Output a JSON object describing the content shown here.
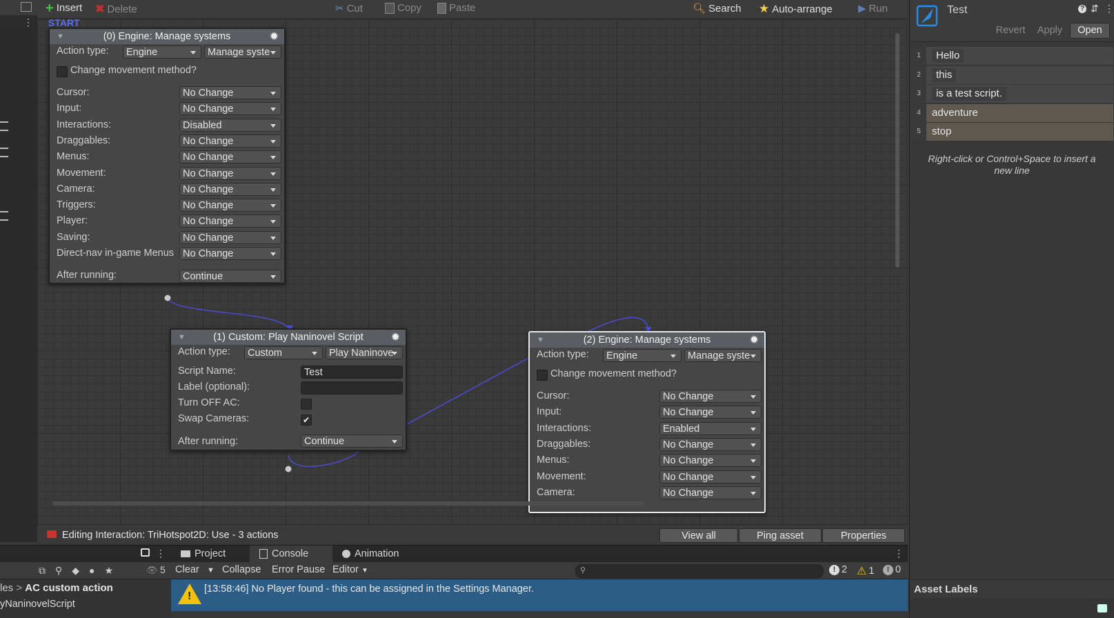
{
  "toolbar": {
    "insert": "Insert",
    "delete": "Delete",
    "cut": "Cut",
    "copy": "Copy",
    "paste": "Paste",
    "search": "Search",
    "auto_arrange": "Auto-arrange",
    "run": "Run"
  },
  "graph": {
    "start_label": "START",
    "node0": {
      "title": "(0) Engine: Manage systems",
      "action_type_label": "Action type:",
      "action_type": "Engine",
      "action_sub": "Manage syste",
      "change_movement": "Change movement method?",
      "fields": [
        {
          "label": "Cursor:",
          "value": "No Change"
        },
        {
          "label": "Input:",
          "value": "No Change"
        },
        {
          "label": "Interactions:",
          "value": "Disabled"
        },
        {
          "label": "Draggables:",
          "value": "No Change"
        },
        {
          "label": "Menus:",
          "value": "No Change"
        },
        {
          "label": "Movement:",
          "value": "No Change"
        },
        {
          "label": "Camera:",
          "value": "No Change"
        },
        {
          "label": "Triggers:",
          "value": "No Change"
        },
        {
          "label": "Player:",
          "value": "No Change"
        },
        {
          "label": "Saving:",
          "value": "No Change"
        },
        {
          "label": "Direct-nav in-game Menus",
          "value": "No Change"
        }
      ],
      "after_running_label": "After running:",
      "after_running": "Continue"
    },
    "node1": {
      "title": "(1) Custom: Play Naninovel Script",
      "action_type_label": "Action type:",
      "action_type": "Custom",
      "action_sub": "Play Naninove",
      "script_name_label": "Script Name:",
      "script_name": "Test",
      "label_optional_label": "Label (optional):",
      "label_optional": "",
      "turn_off_label": "Turn OFF AC:",
      "swap_cameras_label": "Swap Cameras:",
      "after_running_label": "After running:",
      "after_running": "Continue"
    },
    "node2": {
      "title": "(2) Engine: Manage systems",
      "action_type_label": "Action type:",
      "action_type": "Engine",
      "action_sub": "Manage syste",
      "change_movement": "Change movement method?",
      "fields": [
        {
          "label": "Cursor:",
          "value": "No Change"
        },
        {
          "label": "Input:",
          "value": "No Change"
        },
        {
          "label": "Interactions:",
          "value": "Enabled"
        },
        {
          "label": "Draggables:",
          "value": "No Change"
        },
        {
          "label": "Menus:",
          "value": "No Change"
        },
        {
          "label": "Movement:",
          "value": "No Change"
        },
        {
          "label": "Camera:",
          "value": "No Change"
        }
      ]
    }
  },
  "status": {
    "editing": "Editing Interaction: TriHotspot2D: Use - 3 actions",
    "view_all": "View all",
    "ping_asset": "Ping asset",
    "properties": "Properties"
  },
  "console": {
    "tabs": [
      "Project",
      "Console",
      "Animation"
    ],
    "eye_count": "5",
    "clear": "Clear",
    "collapse": "Collapse",
    "error_pause": "Error Pause",
    "editor": "Editor",
    "count_info": "2",
    "count_warn": "1",
    "count_error": "0",
    "log_message": "[13:58:46] No Player found - this can be assigned in the Settings Manager.",
    "breadcrumb_prefix": "les",
    "breadcrumb_current": "AC custom action",
    "file_item": "yNaninovelScript"
  },
  "inspector": {
    "title": "Test",
    "revert": "Revert",
    "apply": "Apply",
    "open": "Open",
    "lines": [
      {
        "num": "1",
        "text": "Hello"
      },
      {
        "num": "2",
        "text": "this"
      },
      {
        "num": "3",
        "text": "is a test script."
      },
      {
        "num": "4",
        "text": "adventure"
      },
      {
        "num": "5",
        "text": "stop"
      }
    ],
    "hint": "Right-click or Control+Space to insert a new line",
    "asset_labels": "Asset Labels"
  },
  "colors": {
    "connection": "#4b4bd6",
    "log_bg": "#2c5d87",
    "warning": "#f4c20d"
  }
}
